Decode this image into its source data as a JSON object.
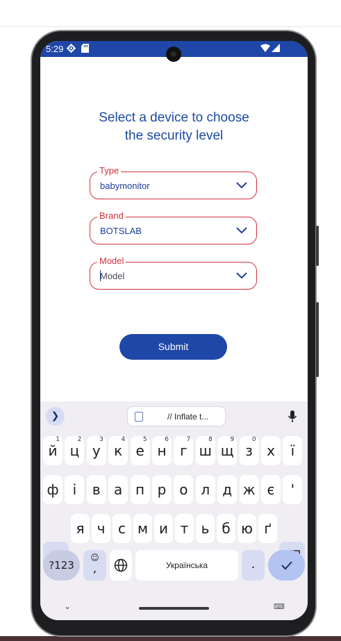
{
  "status_bar": {
    "time": "5:29",
    "icons": [
      "settings-gear-icon",
      "sd-card-icon",
      "wifi-icon",
      "signal-icon"
    ]
  },
  "screen": {
    "title_line1": "Select a device to choose",
    "title_line2": "the security level",
    "fields": [
      {
        "label": "Type",
        "value": "babymonitor",
        "placeholder": ""
      },
      {
        "label": "Brand",
        "value": "BOTSLAB",
        "placeholder": ""
      },
      {
        "label": "Model",
        "value": "",
        "placeholder": "Model"
      }
    ],
    "submit_label": "Submit"
  },
  "keyboard": {
    "clipboard_text": "// Inflate t...",
    "row1": [
      {
        "char": "й",
        "hint": "1"
      },
      {
        "char": "ц",
        "hint": "2"
      },
      {
        "char": "у",
        "hint": "3"
      },
      {
        "char": "к",
        "hint": "4"
      },
      {
        "char": "е",
        "hint": "5"
      },
      {
        "char": "н",
        "hint": "6"
      },
      {
        "char": "г",
        "hint": "7"
      },
      {
        "char": "ш",
        "hint": "8"
      },
      {
        "char": "щ",
        "hint": "9"
      },
      {
        "char": "з",
        "hint": "0"
      },
      {
        "char": "х",
        "hint": ""
      },
      {
        "char": "ї",
        "hint": ""
      }
    ],
    "row2": [
      "ф",
      "і",
      "в",
      "а",
      "п",
      "р",
      "о",
      "л",
      "д",
      "ж",
      "є",
      "'"
    ],
    "row3": [
      "я",
      "ч",
      "с",
      "м",
      "и",
      "т",
      "ь",
      "б",
      "ю",
      "ґ"
    ],
    "symbols_label": "?123",
    "emoji_top": "☺",
    "comma_label": ",",
    "space_label": "Українська",
    "period_label": "."
  },
  "colors": {
    "accent": "#1f47a8",
    "title": "#1c4aa0",
    "field_border": "#d0313b",
    "keyboard_bg": "#f0eef3"
  }
}
